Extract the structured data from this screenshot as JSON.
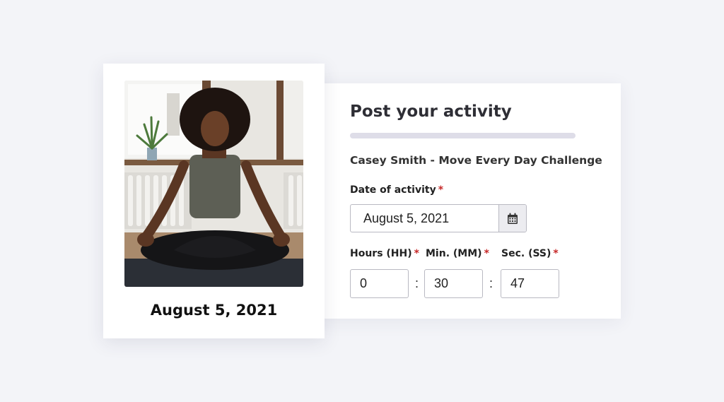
{
  "photo_card": {
    "date": "August 5, 2021"
  },
  "form": {
    "title": "Post your activity",
    "progress": 1.0,
    "challenge": "Casey Smith - Move Every Day Challenge",
    "date_label": "Date of activity",
    "required_mark": "*",
    "date_value": "August 5, 2021",
    "calendar_icon": "calendar-icon",
    "hours_label": "Hours (HH)",
    "minutes_label": "Min. (MM)",
    "seconds_label": "Sec. (SS)",
    "hours_value": "0",
    "minutes_value": "30",
    "seconds_value": "47",
    "separator": ":"
  },
  "colors": {
    "background": "#f3f4f8",
    "required": "#c62828",
    "progress": "#dedde8"
  }
}
